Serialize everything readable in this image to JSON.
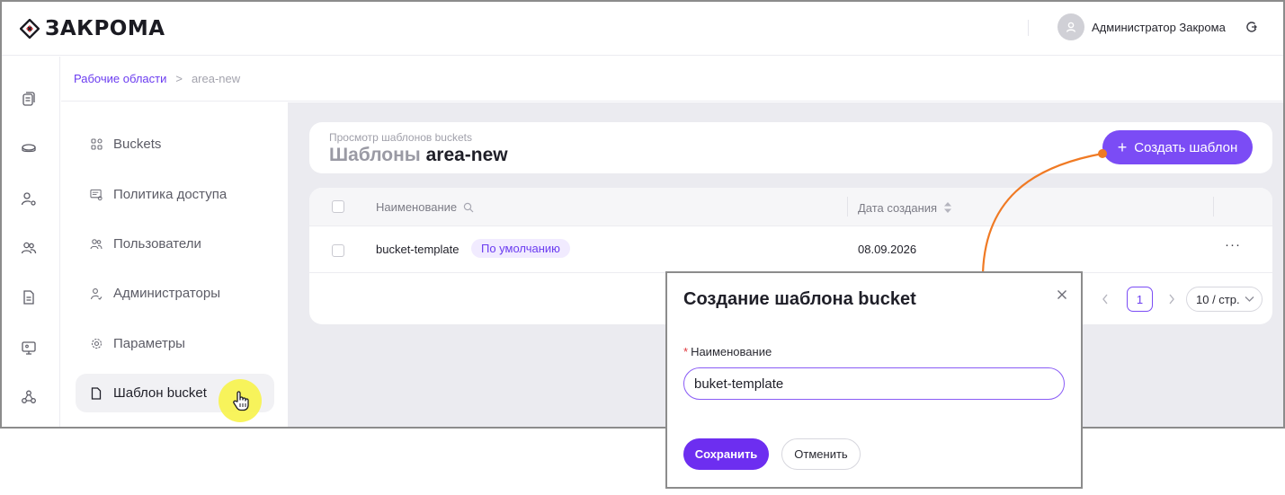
{
  "app": {
    "logo_text": "ЗАКРОМА"
  },
  "header": {
    "user_name": "Администратор Закрома"
  },
  "rail": {
    "icons": [
      "documents-icon",
      "storage-icon",
      "user-settings-icon",
      "users-icon",
      "file-icon",
      "monitor-icon",
      "cluster-icon"
    ]
  },
  "breadcrumb": {
    "root": "Рабочие области",
    "separator": ">",
    "current": "area-new"
  },
  "menu": {
    "items": [
      {
        "label": "Buckets",
        "icon": "buckets-icon"
      },
      {
        "label": "Политика доступа",
        "icon": "policy-icon"
      },
      {
        "label": "Пользователи",
        "icon": "users-icon"
      },
      {
        "label": "Администраторы",
        "icon": "admin-icon"
      },
      {
        "label": "Параметры",
        "icon": "gear-icon"
      },
      {
        "label": "Шаблон bucket",
        "icon": "file-icon",
        "active": true
      }
    ]
  },
  "page": {
    "subtitle": "Просмотр шаблонов buckets",
    "title_prefix": "Шаблоны",
    "title_name": "area-new",
    "create_button": "Создать шаблон"
  },
  "table": {
    "columns": {
      "name": "Наименование",
      "date": "Дата создания"
    },
    "rows": [
      {
        "name": "bucket-template",
        "badge": "По умолчанию",
        "date": "08.09.2026",
        "actions": "···"
      }
    ]
  },
  "pagination": {
    "current_page": "1",
    "page_size": "10 / стр."
  },
  "modal": {
    "title": "Создание шаблона bucket",
    "required_mark": "*",
    "field_label": "Наименование",
    "field_value": "buket-template",
    "save_label": "Сохранить",
    "cancel_label": "Отменить"
  },
  "colors": {
    "accent": "#7b4cf5",
    "annotation_arrow": "#f07a24",
    "cursor_highlight": "#f7f34a"
  }
}
